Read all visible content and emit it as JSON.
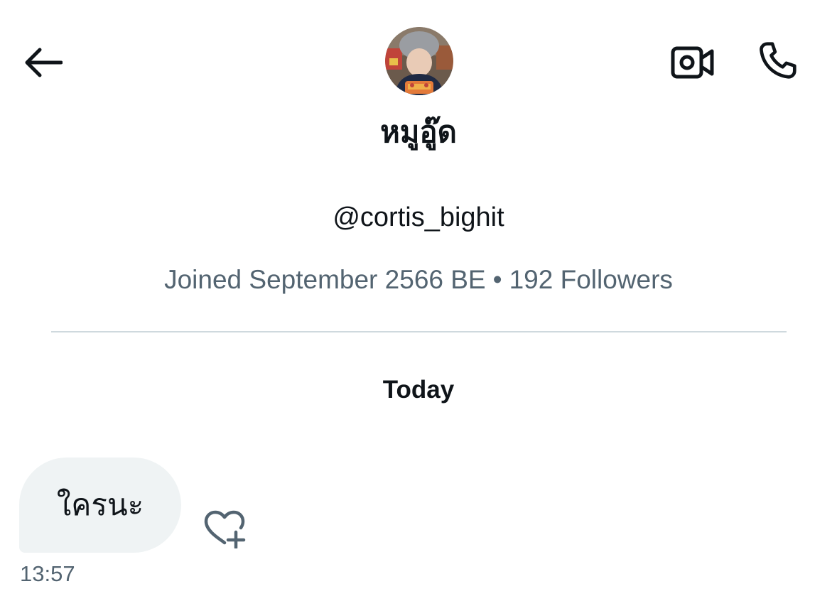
{
  "header": {
    "back_icon": "arrow-left-icon",
    "video_icon": "video-camera-icon",
    "call_icon": "phone-icon"
  },
  "profile": {
    "display_name": "หมูอู๊ด",
    "handle": "@cortis_bighit",
    "joined": "Joined September 2566 BE",
    "separator": "•",
    "followers": "192 Followers"
  },
  "conversation": {
    "date_label": "Today",
    "messages": [
      {
        "text": "ใครนะ",
        "time": "13:57"
      }
    ],
    "react_icon": "heart-plus-icon"
  },
  "colors": {
    "text_primary": "#0f1419",
    "text_secondary": "#536471",
    "bubble_bg": "#eff3f4",
    "divider": "#cfd9de"
  }
}
